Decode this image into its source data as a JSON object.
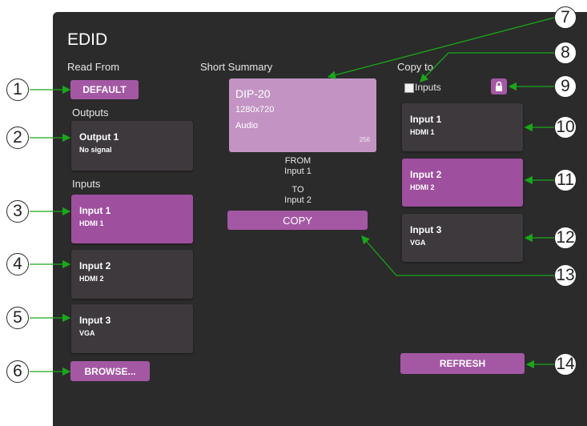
{
  "panel": {
    "title": "EDID",
    "read_from_label": "Read From",
    "default_button": "DEFAULT",
    "outputs_label": "Outputs",
    "inputs_label": "Inputs",
    "outputs": [
      {
        "name": "Output 1",
        "sub": "No signal"
      }
    ],
    "inputs": [
      {
        "name": "Input 1",
        "sub": "HDMI 1",
        "selected": true
      },
      {
        "name": "Input 2",
        "sub": "HDMI 2",
        "selected": false
      },
      {
        "name": "Input 3",
        "sub": "VGA",
        "selected": false
      }
    ],
    "browse_button": "BROWSE...",
    "short_summary_label": "Short Summary",
    "summary": {
      "name": "DIP-20",
      "resolution": "1280x720",
      "audio": "Audio",
      "size": "256"
    },
    "from_label": "FROM",
    "from_value": "Input 1",
    "to_label": "TO",
    "to_value": "Input 2",
    "copy_button": "COPY",
    "copy_to_label": "Copy to",
    "copy_inputs_checkbox": "Inputs",
    "copy_targets": [
      {
        "name": "Input 1",
        "sub": "HDMI 1",
        "selected": false
      },
      {
        "name": "Input 2",
        "sub": "HDMI 2",
        "selected": true
      },
      {
        "name": "Input 3",
        "sub": "VGA",
        "selected": false
      }
    ],
    "refresh_button": "REFRESH"
  },
  "callouts": [
    "1",
    "2",
    "3",
    "4",
    "5",
    "6",
    "7",
    "8",
    "9",
    "10",
    "11",
    "12",
    "13",
    "14"
  ],
  "colors": {
    "panel_bg": "#2b2b2b",
    "accent": "#a458a4",
    "summary_bg": "#c394c3",
    "callout_arrow": "#1aa61a"
  }
}
